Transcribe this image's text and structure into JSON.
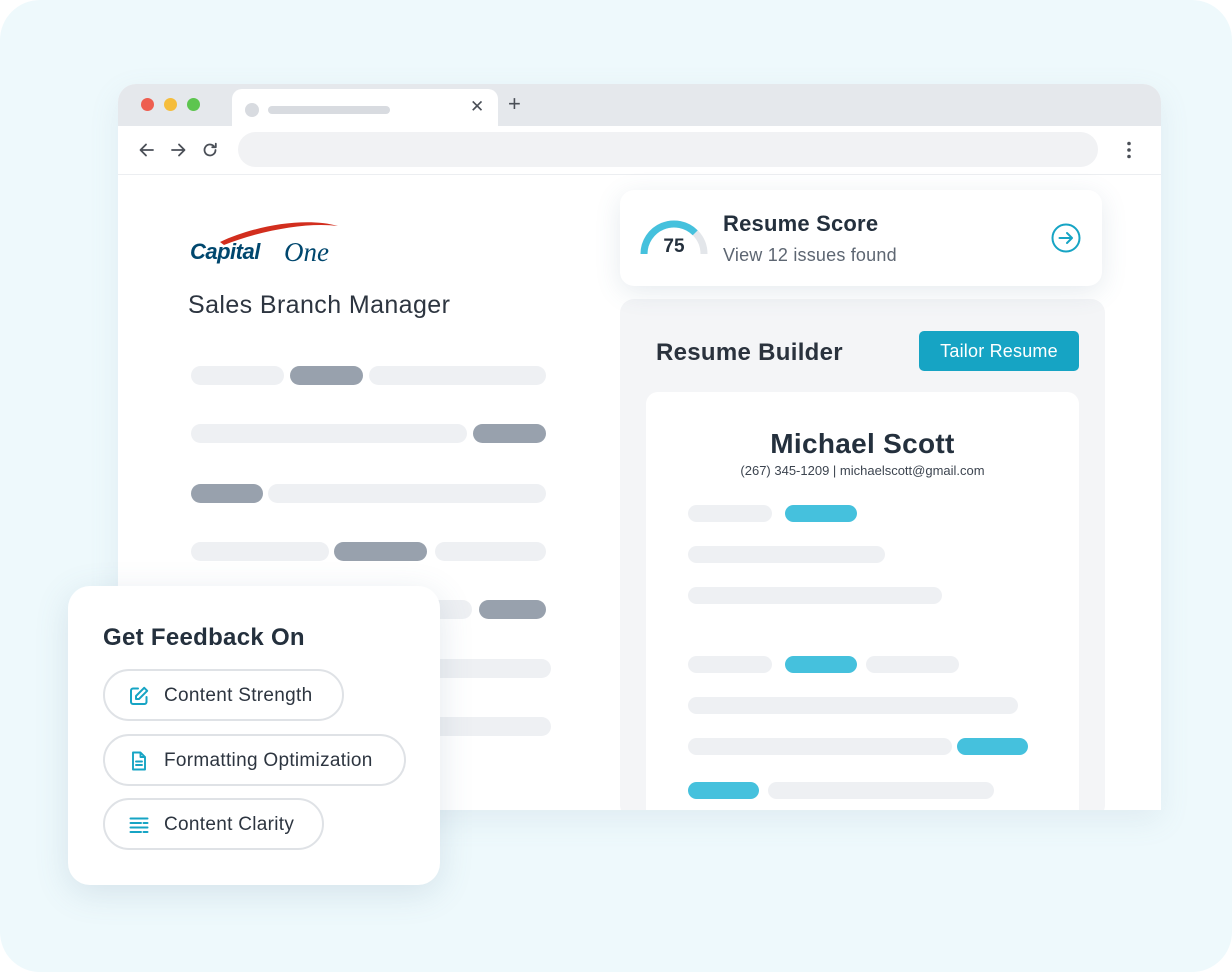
{
  "job": {
    "company_logo_text": "Capital One",
    "title": "Sales Branch Manager"
  },
  "score_card": {
    "score": "75",
    "score_value": 75,
    "title": "Resume Score",
    "subtitle": "View 12 issues found"
  },
  "resume_builder": {
    "title": "Resume Builder",
    "tailor_button_label": "Tailor Resume",
    "resume": {
      "name": "Michael Scott",
      "contact": "(267) 345-1209 | michaelscott@gmail.com"
    }
  },
  "feedback": {
    "title": "Get Feedback On",
    "options": [
      {
        "label": "Content Strength",
        "icon": "edit-icon"
      },
      {
        "label": "Formatting Optimization",
        "icon": "document-icon"
      },
      {
        "label": "Content Clarity",
        "icon": "text-align-icon"
      }
    ]
  },
  "colors": {
    "accent": "#16a4c4",
    "highlight": "#45c1dd",
    "brand_red": "#d22e1e",
    "brand_navy": "#00476e"
  }
}
